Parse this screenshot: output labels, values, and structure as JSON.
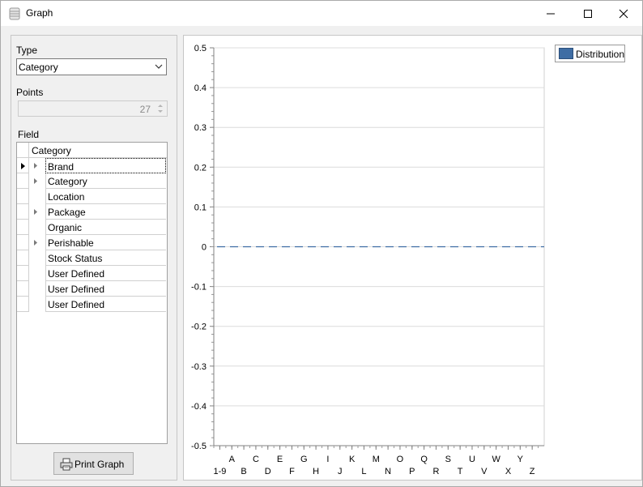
{
  "window": {
    "title": "Graph",
    "icon": "database-icon",
    "controls": [
      "minimize-icon",
      "maximize-icon",
      "close-icon"
    ]
  },
  "left_panel": {
    "type_label": "Type",
    "type_value": "Category",
    "points_label": "Points",
    "points_value": "27",
    "field_label": "Field",
    "grid_header": "Category",
    "rows": [
      {
        "label": "Brand",
        "expandable": true,
        "current": true
      },
      {
        "label": "Category",
        "expandable": true,
        "current": false
      },
      {
        "label": "Location",
        "expandable": false,
        "current": false
      },
      {
        "label": "Package",
        "expandable": true,
        "current": false
      },
      {
        "label": "Organic",
        "expandable": false,
        "current": false
      },
      {
        "label": "Perishable",
        "expandable": true,
        "current": false
      },
      {
        "label": "Stock Status",
        "expandable": false,
        "current": false
      },
      {
        "label": "User Defined",
        "expandable": false,
        "current": false
      },
      {
        "label": "User Defined",
        "expandable": false,
        "current": false
      },
      {
        "label": "User Defined",
        "expandable": false,
        "current": false
      }
    ],
    "print_button": "Print Graph"
  },
  "chart_data": {
    "type": "line",
    "categories": [
      "1-9",
      "A",
      "B",
      "C",
      "D",
      "E",
      "F",
      "G",
      "H",
      "I",
      "J",
      "K",
      "L",
      "M",
      "N",
      "O",
      "P",
      "Q",
      "R",
      "S",
      "T",
      "U",
      "V",
      "W",
      "X",
      "Y",
      "Z"
    ],
    "series": [
      {
        "name": "Distribution",
        "values": [
          0,
          0,
          0,
          0,
          0,
          0,
          0,
          0,
          0,
          0,
          0,
          0,
          0,
          0,
          0,
          0,
          0,
          0,
          0,
          0,
          0,
          0,
          0,
          0,
          0,
          0,
          0
        ]
      }
    ],
    "ylim": [
      -0.5,
      0.5
    ],
    "yticks": [
      "0.5",
      "0.4",
      "0.3",
      "0.2",
      "0.1",
      "0",
      "-0.1",
      "-0.2",
      "-0.3",
      "-0.4",
      "-0.5"
    ],
    "grid": true,
    "legend_position": "top-right",
    "series_color": "#3f6da4"
  }
}
